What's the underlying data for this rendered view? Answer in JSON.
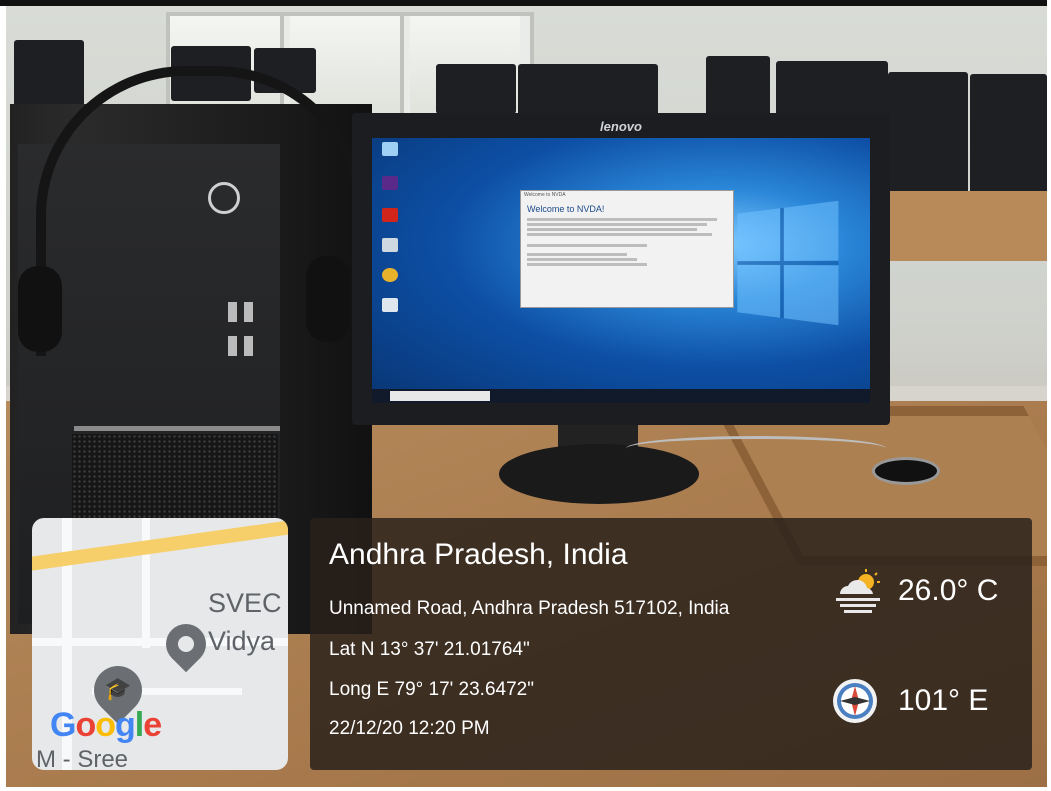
{
  "photo": {
    "monitor_brand": "lenovo",
    "nvda_dialog": {
      "window_title": "Welcome to NVDA",
      "heading": "Welcome to NVDA!"
    },
    "desktop_icons": [
      "This PC",
      "NVDA",
      "Adobe Reader X",
      "Recycle Bin",
      "Google Chrome",
      "Turbo C++"
    ]
  },
  "map": {
    "labels": [
      "SVEC",
      "Vidya",
      "Google",
      "M - Sree"
    ],
    "icons": [
      "location-pin-icon",
      "education-pin-icon"
    ]
  },
  "overlay": {
    "place": "Andhra Pradesh, India",
    "address": "Unnamed Road, Andhra Pradesh 517102, India",
    "latitude": "Lat N 13° 37' 21.01764\"",
    "longitude": "Long E 79° 17' 23.6472\"",
    "datetime": "22/12/20 12:20 PM",
    "temperature": "26.0° C",
    "wind_direction": "101° E",
    "icons": [
      "partly-cloudy-icon",
      "compass-icon"
    ]
  },
  "colors": {
    "overlay_bg": "#28201a",
    "map_road_yellow": "#f6cf6a",
    "google_blue": "#4285f4",
    "google_red": "#ea4335",
    "google_yellow": "#fbbc05",
    "google_green": "#34a853"
  }
}
